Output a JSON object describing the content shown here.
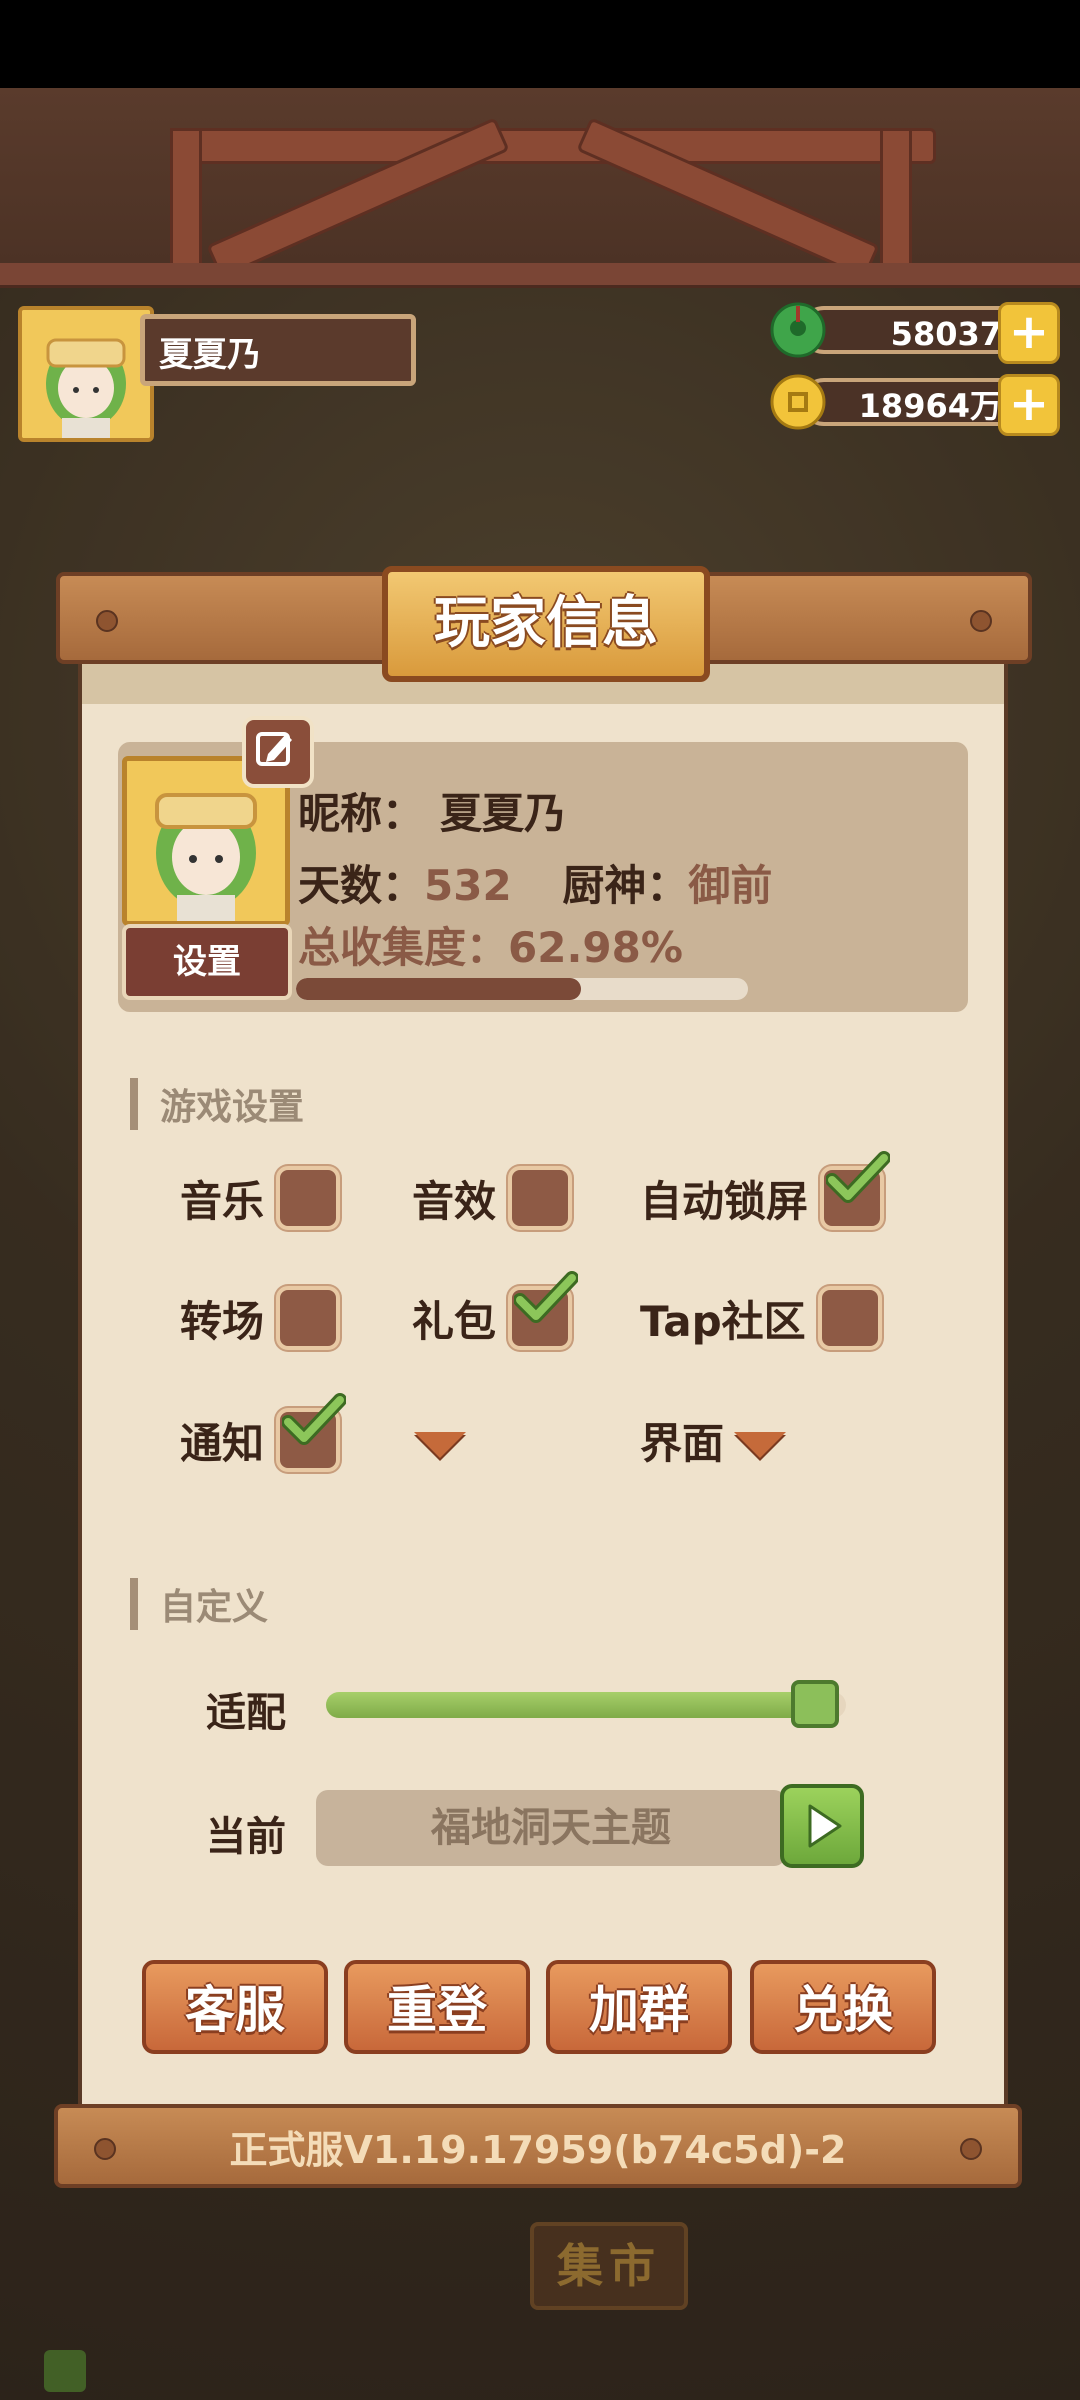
{
  "player": {
    "name": "夏夏乃"
  },
  "currency": {
    "jade": {
      "amount": "58037",
      "icon": "jade-coin-icon",
      "color": "#3fa54a"
    },
    "gold": {
      "amount": "18964万",
      "icon": "gold-coin-icon",
      "color": "#f2c43a"
    },
    "plus_label": "+"
  },
  "dialog": {
    "title": "玩家信息",
    "profile": {
      "nickname_label": "昵称：",
      "nickname": "夏夏乃",
      "days_label": "天数：",
      "days": "532",
      "chef_label": "厨神：",
      "chef": "御前",
      "collection_label": "总收集度：",
      "collection": "62.98%",
      "collection_progress": 0.6298,
      "settings_button": "设置"
    },
    "game_settings": {
      "section_title": "游戏设置",
      "options": [
        {
          "label": "音乐",
          "checked": false
        },
        {
          "label": "音效",
          "checked": false
        },
        {
          "label": "自动锁屏",
          "checked": true
        },
        {
          "label": "转场",
          "checked": false
        },
        {
          "label": "礼包",
          "checked": true
        },
        {
          "label": "Tap社区",
          "checked": false
        },
        {
          "label": "通知",
          "checked": true
        }
      ],
      "dropdown_interface_label": "界面"
    },
    "custom": {
      "section_title": "自定义",
      "adapt_label": "适配",
      "adapt_value": 0.94,
      "current_label": "当前",
      "current_theme": "福地洞天主题"
    },
    "actions": [
      "客服",
      "重登",
      "加群",
      "兑换"
    ],
    "version": "正式服V1.19.17959(b74c5d)-2"
  },
  "background": {
    "market_sign": "集市"
  }
}
